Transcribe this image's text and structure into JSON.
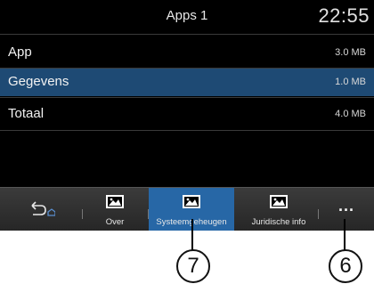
{
  "header": {
    "title": "Apps 1",
    "clock": "22:55"
  },
  "rows": [
    {
      "label": "App",
      "size": "3.0 MB",
      "selected": false
    },
    {
      "label": "Gegevens",
      "size": "1.0 MB",
      "selected": true
    },
    {
      "label": "Totaal",
      "size": "4.0 MB",
      "selected": false
    }
  ],
  "toolbar": {
    "back_icon": "back-arrow-home-icon",
    "tabs": [
      {
        "label": "Over",
        "icon": "image-icon",
        "active": false
      },
      {
        "label": "Systeemgeheugen",
        "icon": "image-icon",
        "active": true
      },
      {
        "label": "Juridische info",
        "icon": "image-icon",
        "active": false
      }
    ],
    "more_label": "..."
  },
  "callouts": [
    "7",
    "6"
  ],
  "colors": {
    "selected_row": "#1e4a74",
    "active_tab": "#2767a6",
    "background": "#000000"
  }
}
